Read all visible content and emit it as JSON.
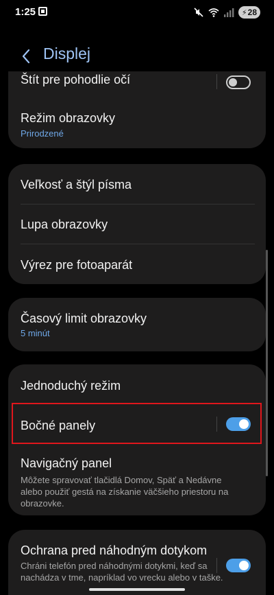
{
  "status_bar": {
    "time": "1:25",
    "battery": "28",
    "icons": [
      "screenshot-icon",
      "mute-icon",
      "wifi-icon",
      "signal-icon",
      "battery-charging-icon"
    ]
  },
  "header": {
    "title": "Displej",
    "back_icon": "chevron-left-icon"
  },
  "settings": {
    "eye_comfort": {
      "title": "Štít pre pohodlie očí",
      "enabled": false
    },
    "screen_mode": {
      "title": "Režim obrazovky",
      "value": "Prirodzené"
    },
    "font_style": {
      "title": "Veľkosť a štýl písma"
    },
    "magnifier": {
      "title": "Lupa obrazovky"
    },
    "camera_cutout": {
      "title": "Výrez pre fotoaparát"
    },
    "screen_timeout": {
      "title": "Časový limit obrazovky",
      "value": "5 minút"
    },
    "easy_mode": {
      "title": "Jednoduchý režim"
    },
    "edge_panels": {
      "title": "Bočné panely",
      "enabled": true
    },
    "navigation_bar": {
      "title": "Navigačný panel",
      "description": "Môžete spravovať tlačidlá Domov, Späť a Nedávne alebo použiť gestá na získanie väčšieho priestoru na obrazovke."
    },
    "accidental_touch": {
      "title": "Ochrana pred náhodným dotykom",
      "description": "Chráni telefón pred náhodnými dotykmi, keď sa nachádza v tme, napríklad vo vrecku alebo v taške.",
      "enabled": true
    }
  },
  "colors": {
    "accent": "#4d9fe8",
    "highlight": "#e0161c",
    "card": "#1e1d1d"
  }
}
